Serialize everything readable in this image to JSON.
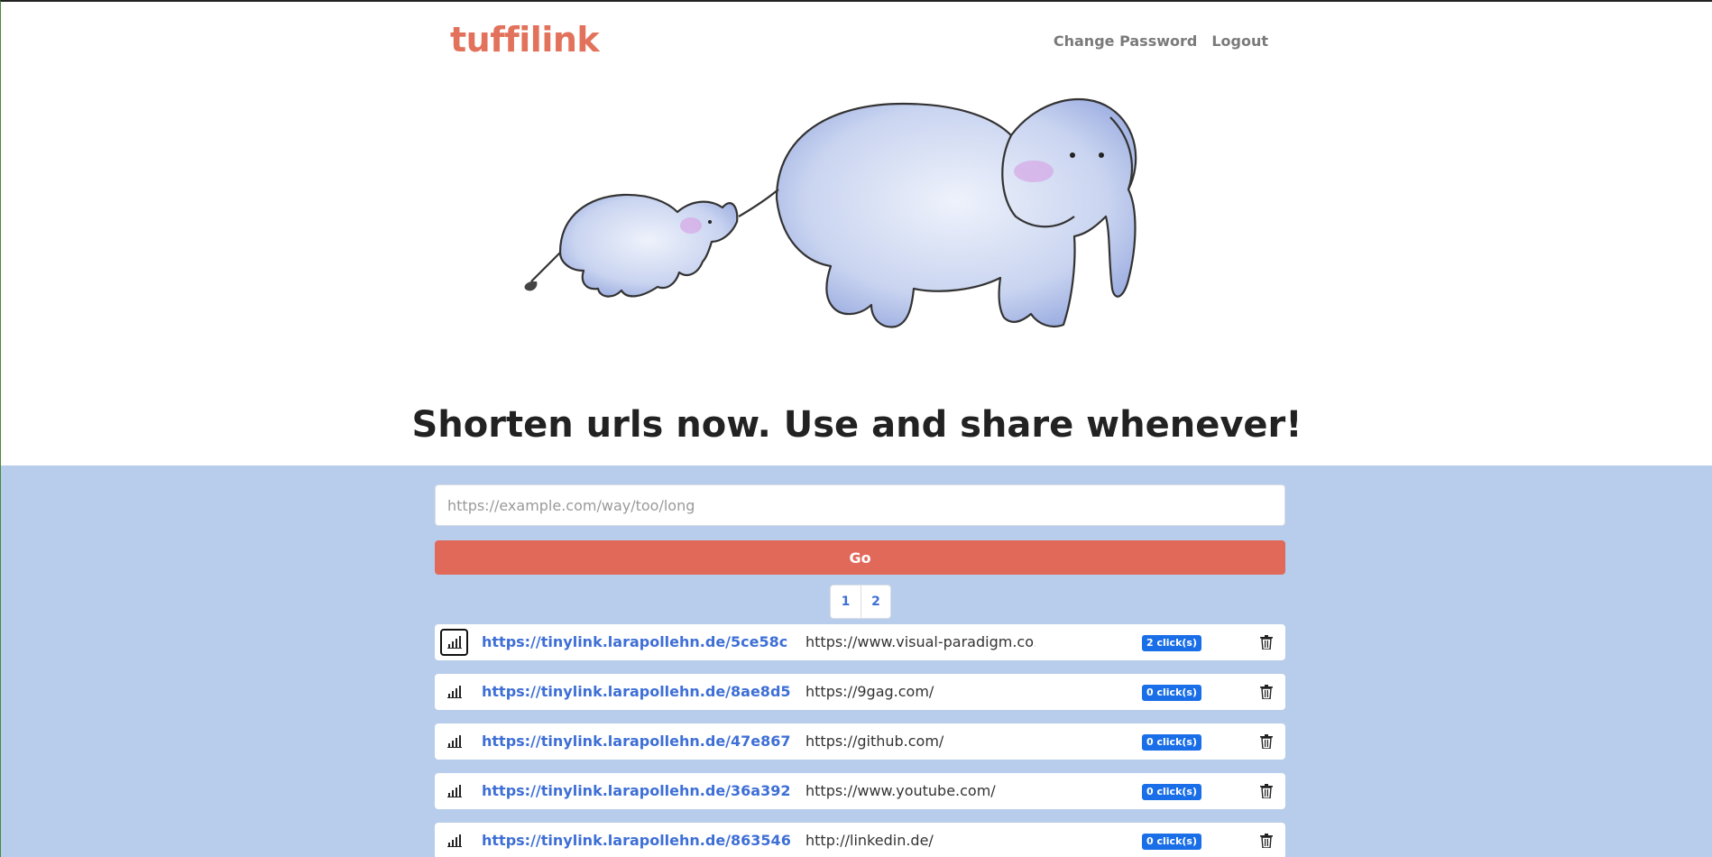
{
  "header": {
    "brand": "tuffilink",
    "nav": [
      {
        "label": "Change Password"
      },
      {
        "label": "Logout"
      }
    ]
  },
  "hero": {
    "headline": "Shorten urls now. Use and share whenever!"
  },
  "shorten_form": {
    "placeholder": "https://example.com/way/too/long",
    "value": "",
    "go_label": "Go"
  },
  "pagination": [
    "1",
    "2"
  ],
  "links": [
    {
      "short": "https://tinylink.larapollehn.de/5ce58c",
      "original": "https://www.visual-paradigm.co…",
      "clicks": "2 click(s)",
      "active": true
    },
    {
      "short": "https://tinylink.larapollehn.de/8ae8d5",
      "original": "https://9gag.com/",
      "clicks": "0 click(s)",
      "active": false
    },
    {
      "short": "https://tinylink.larapollehn.de/47e867",
      "original": "https://github.com/",
      "clicks": "0 click(s)",
      "active": false
    },
    {
      "short": "https://tinylink.larapollehn.de/36a392",
      "original": "https://www.youtube.com/",
      "clicks": "0 click(s)",
      "active": false
    },
    {
      "short": "https://tinylink.larapollehn.de/863546",
      "original": "http://linkedin.de/",
      "clicks": "0 click(s)",
      "active": false
    }
  ],
  "icons": {
    "stats": "bar-chart-icon",
    "delete": "trash-icon"
  },
  "colors": {
    "brand": "#e2725b",
    "go_button": "#e0695a",
    "background_band": "#b8cdeb",
    "link": "#3e6fd6",
    "badge": "#1a6fe8"
  }
}
